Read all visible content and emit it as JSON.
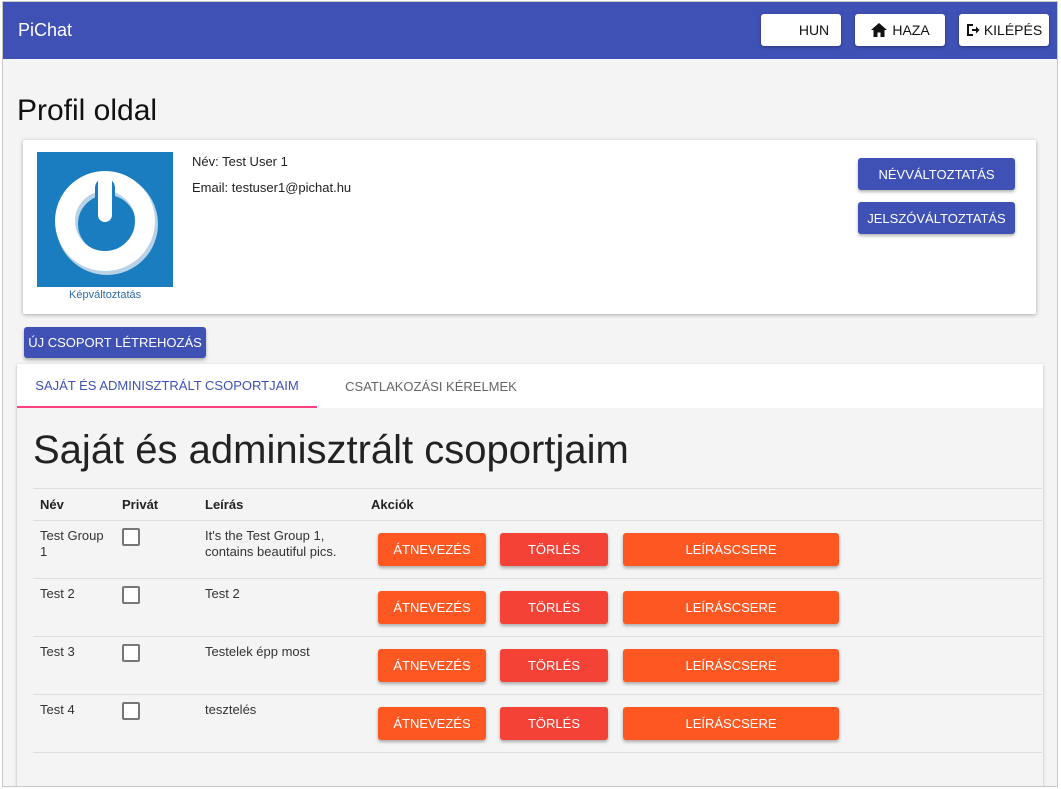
{
  "app": {
    "title": "PiChat"
  },
  "topbar": {
    "lang_label": "HUN",
    "home_label": "HAZA",
    "logout_label": "KILÉPÉS"
  },
  "profile": {
    "page_title": "Profil oldal",
    "name_line": "Név: Test User 1",
    "email_line": "Email: testuser1@pichat.hu",
    "change_picture": "Képváltoztatás",
    "change_name_button": "NÉVVÁLTOZTATÁS",
    "change_password_button": "JELSZÓVÁLTOZTATÁS"
  },
  "new_group_button": "ÚJ CSOPORT LÉTREHOZÁS",
  "tabs": [
    {
      "label": "SAJÁT ÉS ADMINISZTRÁLT CSOPORTJAIM",
      "active": true
    },
    {
      "label": "CSATLAKOZÁSI KÉRELMEK",
      "active": false
    }
  ],
  "groups_section": {
    "title": "Saját és adminisztrált csoportjaim",
    "columns": [
      "Név",
      "Privát",
      "Leírás",
      "Akciók"
    ],
    "rows": [
      {
        "name": "Test Group 1",
        "private": false,
        "description": "It's the Test Group 1, contains beautiful pics."
      },
      {
        "name": "Test 2",
        "private": false,
        "description": "Test 2"
      },
      {
        "name": "Test 3",
        "private": false,
        "description": "Testelek épp most"
      },
      {
        "name": "Test 4",
        "private": false,
        "description": "tesztelés"
      }
    ],
    "actions": {
      "rename": "ÁTNEVEZÉS",
      "delete": "TÖRLÉS",
      "change_description": "LEÍRÁSCSERE"
    }
  },
  "colors": {
    "primary": "#3f51b5",
    "accent_tab": "#ff4081",
    "rename_button": "#ff5722",
    "delete_button": "#f44336",
    "avatar_bg": "#1a7dc0"
  },
  "icons": [
    "hungary-flag-icon",
    "home-icon",
    "logout-icon",
    "power-logo-icon"
  ]
}
